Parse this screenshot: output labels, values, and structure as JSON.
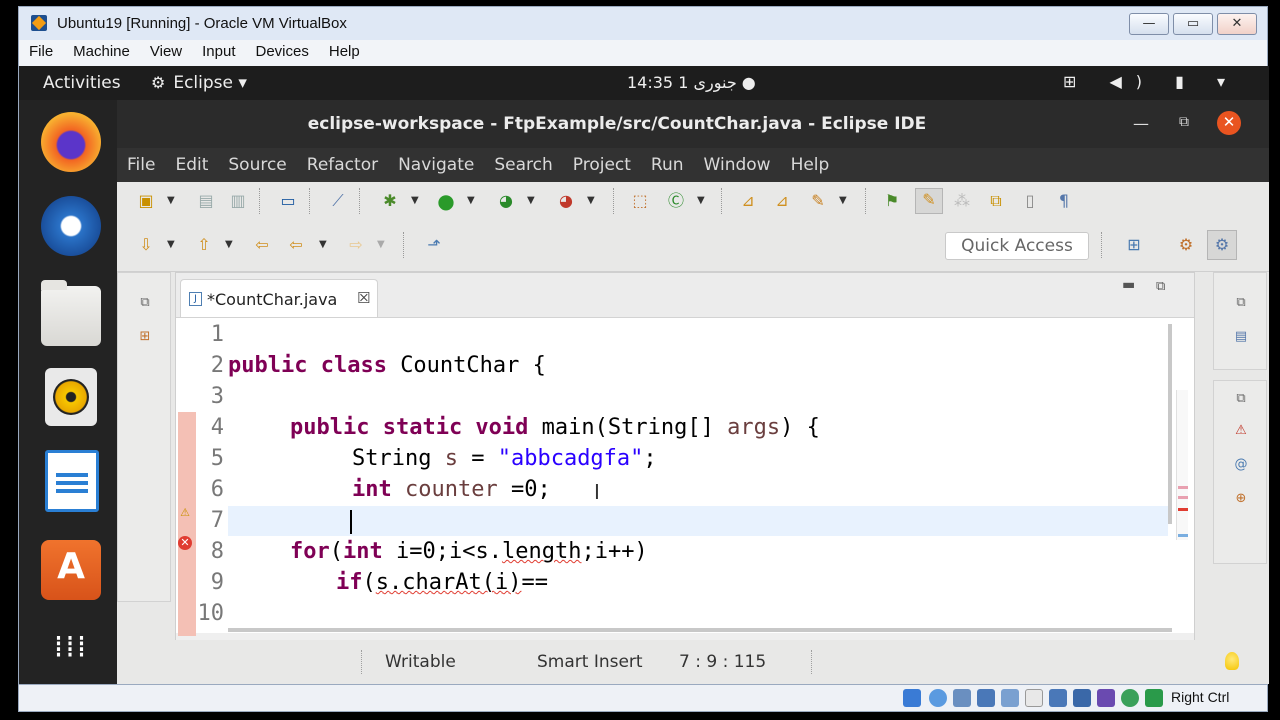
{
  "vbox": {
    "title": "Ubuntu19 [Running] - Oracle VM VirtualBox",
    "menu": [
      "File",
      "Machine",
      "View",
      "Input",
      "Devices",
      "Help"
    ],
    "min_glyph": "—",
    "max_glyph": "▭",
    "close_glyph": "✕",
    "host_key": "Right Ctrl"
  },
  "ubuntu": {
    "activities": "Activities",
    "app_menu": "Eclipse ▾",
    "clock": "14:35  1 جنوری ●",
    "tray_icons": "⊞ ◀) ▮ ▾",
    "dock": [
      "firefox-icon",
      "thunderbird-icon",
      "files-icon",
      "rhythmbox-icon",
      "libreoffice-writer-icon",
      "ubuntu-software-icon",
      "show-applications-icon"
    ],
    "apps_glyph": "⁞⁞⁞"
  },
  "eclipse": {
    "title": "eclipse-workspace - FtpExample/src/CountChar.java - Eclipse IDE",
    "menu": [
      "File",
      "Edit",
      "Source",
      "Refactor",
      "Navigate",
      "Search",
      "Project",
      "Run",
      "Window",
      "Help"
    ],
    "quick_access": "Quick Access",
    "tab_label": "*CountChar.java",
    "tab_close": "☒",
    "status": {
      "writable": "Writable",
      "insert_mode": "Smart Insert",
      "position": "7 : 9 : 115"
    },
    "code": {
      "line_numbers": [
        "1",
        "2",
        "3",
        "4",
        "5",
        "6",
        "7",
        "8",
        "9",
        "10"
      ],
      "l2_kw": "public class ",
      "l2_rest": "CountChar {",
      "l4_kw": "public static void ",
      "l4_a": "main(String[] ",
      "l4_var": "args",
      "l4_b": ") {",
      "l5_a": "String ",
      "l5_var": "s",
      "l5_b": " = ",
      "l5_str": "\"abbcadgfa\"",
      "l5_c": ";",
      "l6_kw": "int ",
      "l6_var": "counter",
      "l6_b": " =0;",
      "l8_kw1": "for",
      "l8_a": "(",
      "l8_kw2": "int",
      "l8_b": " i=0;i<s.",
      "l8_sq": "length",
      "l8_c": ";i++)",
      "l9_kw": "if",
      "l9_a": "(",
      "l9_sq": "s.charAt(i)",
      "l9_b": "=="
    }
  },
  "colors": {
    "accent_orange": "#e95420",
    "keyword": "#7f0055",
    "string": "#2a00ff",
    "error": "#e03c31"
  }
}
